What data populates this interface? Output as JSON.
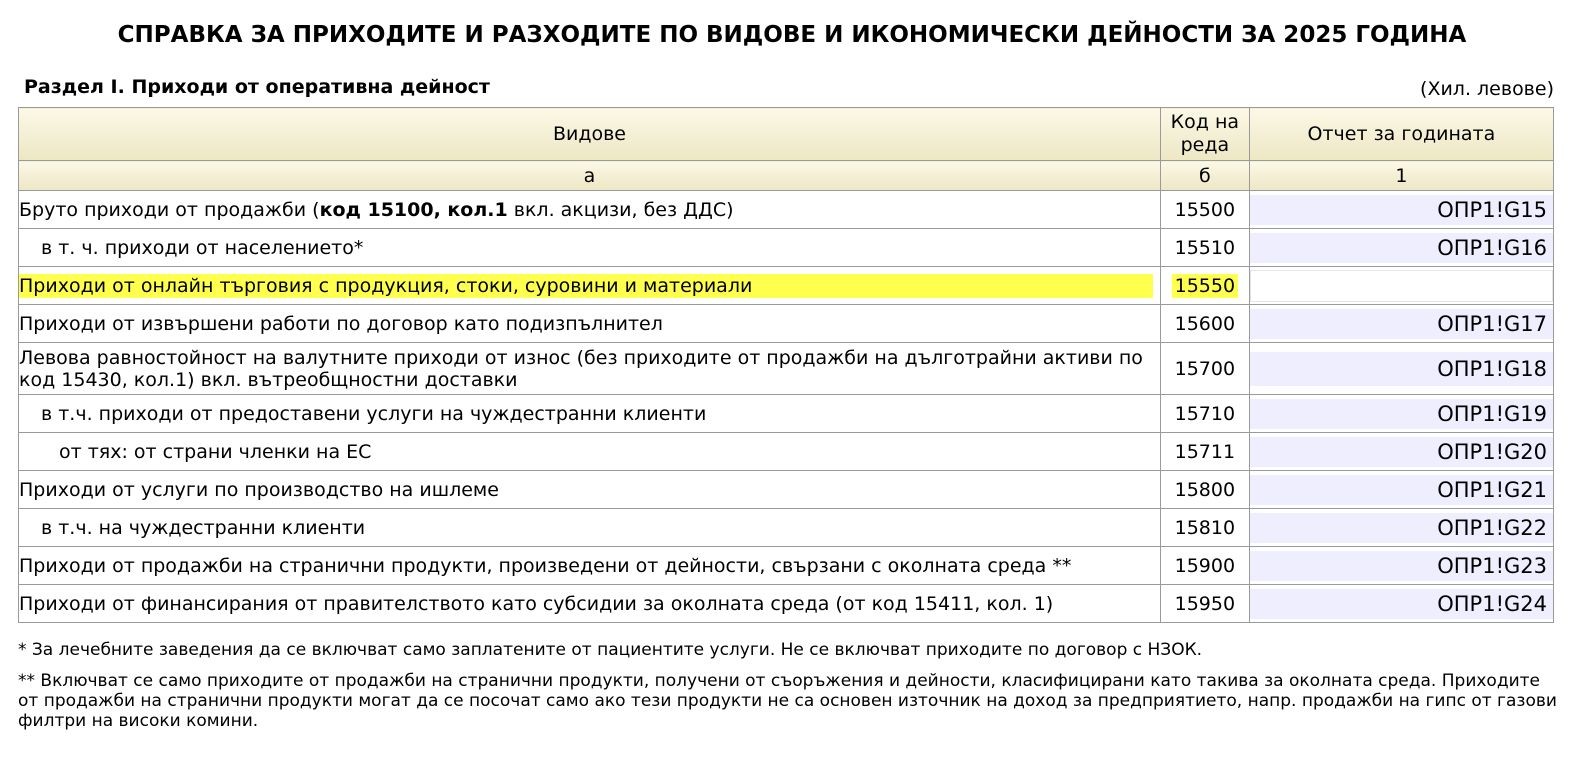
{
  "title": "СПРАВКА ЗА ПРИХОДИТЕ И РАЗХОДИТЕ ПО ВИДОВЕ И ИКОНОМИЧЕСКИ ДЕЙНОСТИ ЗА 2025 ГОДИНА",
  "section_title": "Раздел I. Приходи от оперативна дейност",
  "units": "(Хил. левове)",
  "table": {
    "headers": {
      "types": "Видове",
      "code": "Код на реда",
      "report": "Отчет за годината"
    },
    "subheaders": {
      "a": "а",
      "b": "б",
      "c": "1"
    },
    "rows": [
      {
        "desc_pre": "Бруто приходи от продажби (",
        "desc_bold": "код 15100, кол.1",
        "desc_post": " вкл. акцизи, без ДДС)",
        "code": "15500",
        "value": "ОПР1!G15"
      },
      {
        "desc": "в т. ч. приходи от населението*",
        "code": "15510",
        "value": "ОПР1!G16"
      },
      {
        "desc": "Приходи от онлайн търговия с продукция, стоки, суровини и материали",
        "code": "15550",
        "value": ""
      },
      {
        "desc": "Приходи от извършени работи по договор като подизпълнител",
        "code": "15600",
        "value": "ОПР1!G17"
      },
      {
        "desc": "Левова равностойност на валутните приходи от износ (без приходите от продажби на дълготрайни активи по код 15430, кол.1) вкл. вътреобщностни доставки",
        "code": "15700",
        "value": "ОПР1!G18"
      },
      {
        "desc": "в т.ч. приходи от предоставени услуги на чуждестранни клиенти",
        "code": "15710",
        "value": "ОПР1!G19"
      },
      {
        "desc": "от тях: от страни членки на ЕС",
        "code": "15711",
        "value": "ОПР1!G20"
      },
      {
        "desc": "Приходи от услуги по производство на ишлеме",
        "code": "15800",
        "value": "ОПР1!G21"
      },
      {
        "desc": "в т.ч. на чуждестранни клиенти",
        "code": "15810",
        "value": "ОПР1!G22"
      },
      {
        "desc": "Приходи от продажби на странични продукти, произведени от дейности, свързани с околната среда **",
        "code": "15900",
        "value": "ОПР1!G23"
      },
      {
        "desc": "Приходи от финансирания от правителството като субсидии за околната среда (от код 15411, кол. 1)",
        "code": "15950",
        "value": "ОПР1!G24"
      }
    ]
  },
  "notes": {
    "note1": "* За лечебните заведения да се включват само заплатените от пациентите услуги. Не се включват приходите по договор с НЗОК.",
    "note2": "** Включват се само приходите от продажби на странични продукти, получени от съоръжения и дейности, класифицирани като такива за околната среда. Приходите от продажби на странични продукти могат да се посочат само ако тези продукти не са основен източник на доход за предприятието, напр. продажби на гипс от газови филтри на високи комини."
  },
  "colors": {
    "header_bg": "#f5f0d6",
    "highlight": "#ffff4d",
    "value_cell_bg": "#eeeeff",
    "border": "#9a9a9a"
  }
}
